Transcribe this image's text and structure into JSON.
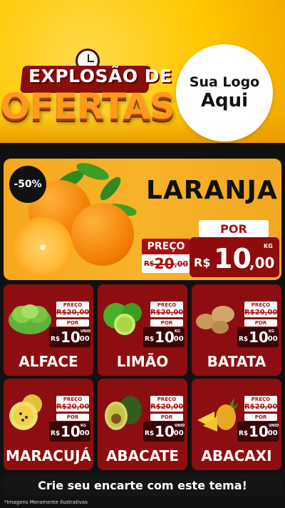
{
  "header": {
    "title_line1": "EXPLOSÃO DE",
    "title_line2": "OFERTAS",
    "logo_line1": "Sua Logo",
    "logo_line2": "Aqui"
  },
  "hero": {
    "discount": "-50%",
    "name": "LARANJA",
    "preco_label": "PREÇO",
    "old_currency": "R$",
    "old_int": "20",
    "old_dec": ",00",
    "por_label": "POR",
    "new_currency": "R$",
    "new_int": "10",
    "new_dec": ",00",
    "unit": "KG"
  },
  "products": [
    {
      "name": "ALFACE",
      "preco_label": "PREÇO",
      "old_price": "R$20,00",
      "por_label": "POR",
      "currency": "R$",
      "price_int": "10",
      "price_dec": ",00",
      "unit": "UNID"
    },
    {
      "name": "LIMÃO",
      "preco_label": "PREÇO",
      "old_price": "R$20,00",
      "por_label": "POR",
      "currency": "R$",
      "price_int": "10",
      "price_dec": ",00",
      "unit": "KG"
    },
    {
      "name": "BATATA",
      "preco_label": "PREÇO",
      "old_price": "R$20,00",
      "por_label": "POR",
      "currency": "R$",
      "price_int": "10",
      "price_dec": ",00",
      "unit": "KG"
    },
    {
      "name": "MARACUJÁ",
      "preco_label": "PREÇO",
      "old_price": "R$20,00",
      "por_label": "POR",
      "currency": "R$",
      "price_int": "10",
      "price_dec": ",00",
      "unit": "KG"
    },
    {
      "name": "ABACATE",
      "preco_label": "PREÇO",
      "old_price": "R$20,00",
      "por_label": "POR",
      "currency": "R$",
      "price_int": "10",
      "price_dec": ",00",
      "unit": "UNID"
    },
    {
      "name": "ABACAXI",
      "preco_label": "PREÇO",
      "old_price": "R$20,00",
      "por_label": "POR",
      "currency": "R$",
      "price_int": "10",
      "price_dec": ",00",
      "unit": "UNID"
    }
  ],
  "footer": {
    "cta": "Crie seu encarte com este tema!",
    "disclaimer": "*Imagens Meramente Ilustrativas"
  },
  "colors": {
    "header_yellow": "#ffc800",
    "card_red": "#8d0e10",
    "hero_orange": "#f6a81e",
    "price_red": "#a80f0f"
  }
}
